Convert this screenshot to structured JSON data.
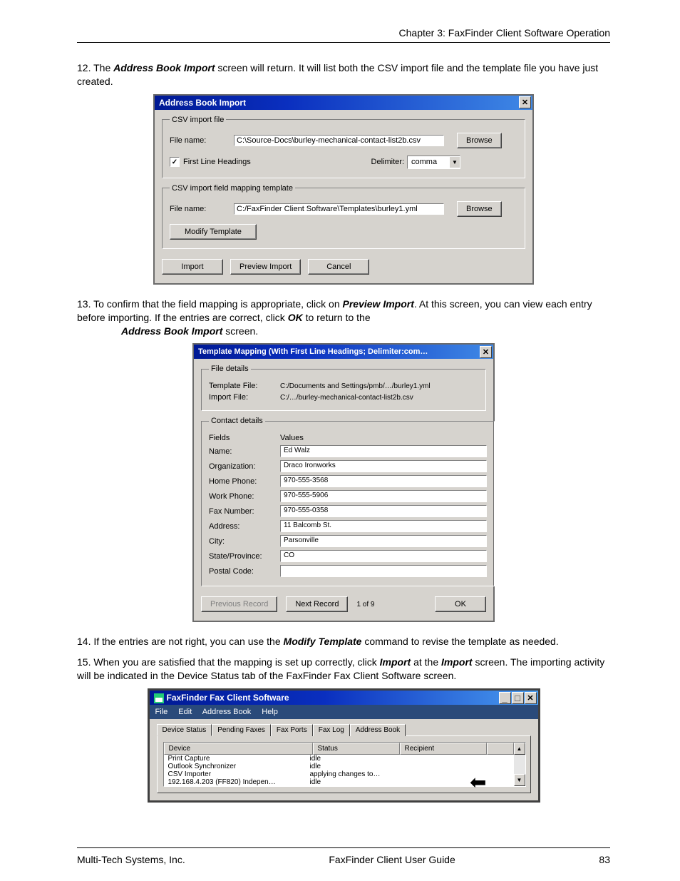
{
  "header": "Chapter 3: FaxFinder Client Software Operation",
  "footer": {
    "left": "Multi-Tech Systems, Inc.",
    "center": "FaxFinder Client User Guide",
    "right": "83"
  },
  "p12": {
    "n": "12.",
    "t1": "The ",
    "b1": "Address Book Import",
    "t2": " screen will return.  It will list both the CSV import file and the template file you have just created."
  },
  "win1": {
    "title": "Address Book Import",
    "fs1": {
      "legend": "CSV import file",
      "fname_lbl": "File name:",
      "fname": "C:\\Source-Docs\\burley-mechanical-contact-list2b.csv",
      "browse": "Browse",
      "flh": "First Line Headings",
      "delim_lbl": "Delimiter:",
      "delim": "comma"
    },
    "fs2": {
      "legend": "CSV import field mapping template",
      "fname_lbl": "File name:",
      "fname": "C:/FaxFinder Client Software\\Templates\\burley1.yml",
      "browse": "Browse",
      "modify": "Modify Template"
    },
    "import": "Import",
    "preview": "Preview Import",
    "cancel": "Cancel"
  },
  "p13": {
    "n": "13.",
    "t1": "To confirm that the field mapping is appropriate, click on ",
    "b1": "Preview Import",
    "t2": ".  At this screen, you can view each entry before importing.  If the entries are correct, click ",
    "b2": "OK",
    "t3": " to return to the ",
    "b3": "Address Book Import",
    "t4": " screen."
  },
  "win2": {
    "title": "Template Mapping (With First Line Headings; Delimiter:com…",
    "fs1": {
      "legend": "File details",
      "tfile_lbl": "Template File:",
      "tfile": "C:/Documents and Settings/pmb/…/burley1.yml",
      "ifile_lbl": "Import File:",
      "ifile": "C:/…/burley-mechanical-contact-list2b.csv"
    },
    "fs2": {
      "legend": "Contact details",
      "fields": "Fields",
      "values": "Values",
      "rows": [
        {
          "f": "Name:",
          "v": "Ed Walz"
        },
        {
          "f": "Organization:",
          "v": "Draco Ironworks"
        },
        {
          "f": "Home Phone:",
          "v": "970-555-3568"
        },
        {
          "f": "Work Phone:",
          "v": "970-555-5906"
        },
        {
          "f": "Fax Number:",
          "v": "970-555-0358"
        },
        {
          "f": "Address:",
          "v": "11 Balcomb St."
        },
        {
          "f": "City:",
          "v": "Parsonville"
        },
        {
          "f": "State/Province:",
          "v": "CO"
        },
        {
          "f": "Postal Code:",
          "v": ""
        }
      ]
    },
    "prev": "Previous Record",
    "next": "Next Record",
    "counter": "1 of 9",
    "ok": "OK"
  },
  "p14": {
    "n": "14.",
    "t1": "If the entries are not right, you can use the ",
    "b1": "Modify Template",
    "t2": " command to revise the template as needed."
  },
  "p15": {
    "n": "15.",
    "t1": "When you are satisfied that the mapping is set up correctly, click ",
    "b1": "Import",
    "t2": " at the ",
    "b2": "Import",
    "t3": " screen.  The importing activity will be indicated in the Device Status tab of the FaxFinder Fax Client Software screen."
  },
  "win3": {
    "title": "FaxFinder Fax Client Software",
    "menu": [
      "File",
      "Edit",
      "Address Book",
      "Help"
    ],
    "tabs": [
      "Device Status",
      "Pending Faxes",
      "Fax Ports",
      "Fax Log",
      "Address Book"
    ],
    "cols": {
      "device": "Device",
      "status": "Status",
      "recipient": "Recipient"
    },
    "rows": [
      {
        "d": "Print Capture",
        "s": "idle",
        "r": ""
      },
      {
        "d": "Outlook Synchronizer",
        "s": "idle",
        "r": ""
      },
      {
        "d": "CSV Importer",
        "s": "applying changes to…",
        "r": ""
      },
      {
        "d": "192.168.4.203 (FF820) Indepen…",
        "s": "idle",
        "r": ""
      }
    ]
  }
}
